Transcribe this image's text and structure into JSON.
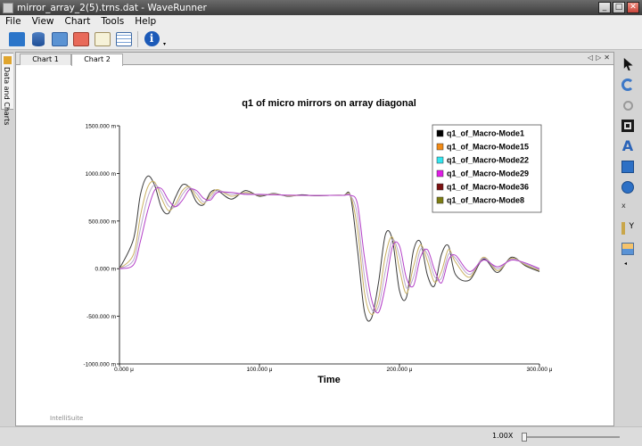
{
  "window": {
    "title": "mirror_array_2(5).trns.dat - WaveRunner",
    "minimize": "_",
    "maximize": "□",
    "close": "✕"
  },
  "menu": [
    "File",
    "View",
    "Chart",
    "Tools",
    "Help"
  ],
  "toolbar": {
    "icons": [
      "folder-open-icon",
      "database-icon",
      "add-data-icon",
      "remove-data-icon",
      "waveform-icon",
      "table-icon",
      "info-icon"
    ],
    "info_glyph": "i",
    "more_glyph": "▾"
  },
  "left_tab": {
    "label": "Data and Charts"
  },
  "tabs": [
    {
      "label": "Chart 1"
    },
    {
      "label": "Chart 2",
      "active": true
    }
  ],
  "tab_nav": {
    "prev": "◁",
    "next": "▷",
    "close": "✕"
  },
  "chart_data": {
    "type": "line",
    "title": "q1 of micro mirrors on array diagonal",
    "xlabel": "Time",
    "ylabel": "",
    "xlim": [
      0,
      300
    ],
    "ylim": [
      -1000,
      1500
    ],
    "x_unit": "μ",
    "y_unit": "m",
    "xticks": [
      "0.000 μ",
      "100.000 μ",
      "200.000 μ",
      "300.000 μ"
    ],
    "xtick_values": [
      0,
      100,
      200,
      300
    ],
    "yticks": [
      "1500.000 m",
      "1000.000 m",
      "500.000 m",
      "0.000 m",
      "-500.000 m",
      "-1000.000 m"
    ],
    "ytick_values": [
      1500,
      1000,
      500,
      0,
      -500,
      -1000
    ],
    "grid": false,
    "legend_position": "top-right",
    "series": [
      {
        "name": "q1_of_Macro-Mode1",
        "color": "#000000",
        "line_color": "#3a3a3a",
        "x": [
          0,
          10,
          15,
          20,
          25,
          30,
          35,
          40,
          45,
          50,
          55,
          60,
          65,
          70,
          80,
          90,
          100,
          110,
          120,
          130,
          140,
          150,
          160,
          165,
          170,
          175,
          180,
          185,
          190,
          195,
          200,
          205,
          210,
          215,
          220,
          225,
          230,
          235,
          240,
          250,
          260,
          270,
          280,
          290,
          300
        ],
        "y": [
          0,
          310,
          780,
          970,
          880,
          640,
          580,
          750,
          880,
          850,
          700,
          670,
          800,
          820,
          730,
          820,
          760,
          790,
          760,
          775,
          765,
          770,
          770,
          760,
          200,
          -450,
          -520,
          -150,
          360,
          300,
          -230,
          -300,
          190,
          280,
          -70,
          -180,
          150,
          240,
          -60,
          -120,
          100,
          -40,
          120,
          30,
          -30
        ]
      },
      {
        "name": "q1_of_Macro-Mode15",
        "color": "#f28a14",
        "line_color": "#c9b060",
        "x": [
          0,
          10,
          15,
          20,
          25,
          30,
          35,
          40,
          45,
          50,
          55,
          60,
          65,
          70,
          80,
          90,
          100,
          110,
          120,
          130,
          140,
          150,
          160,
          165,
          170,
          175,
          180,
          185,
          190,
          195,
          200,
          205,
          210,
          215,
          220,
          225,
          230,
          235,
          240,
          250,
          260,
          270,
          280,
          290,
          300
        ],
        "y": [
          0,
          150,
          560,
          850,
          910,
          740,
          610,
          680,
          820,
          860,
          750,
          680,
          770,
          830,
          760,
          800,
          770,
          785,
          765,
          770,
          768,
          770,
          770,
          765,
          420,
          -250,
          -480,
          -320,
          140,
          330,
          0,
          -260,
          20,
          250,
          80,
          -140,
          -30,
          200,
          70,
          -90,
          120,
          -20,
          110,
          40,
          -20
        ]
      },
      {
        "name": "q1_of_Macro-Mode22",
        "color": "#33e6f0",
        "line_color": "#b9a7cc",
        "x": [
          0,
          10,
          15,
          20,
          25,
          30,
          35,
          40,
          45,
          50,
          55,
          60,
          65,
          70,
          80,
          90,
          100,
          110,
          120,
          130,
          140,
          150,
          160,
          165,
          170,
          175,
          180,
          185,
          190,
          195,
          200,
          205,
          210,
          215,
          220,
          225,
          230,
          235,
          240,
          250,
          260,
          270,
          280,
          290,
          300
        ],
        "y": [
          0,
          90,
          420,
          740,
          880,
          800,
          660,
          650,
          780,
          850,
          790,
          700,
          740,
          820,
          780,
          790,
          775,
          780,
          770,
          770,
          768,
          770,
          770,
          768,
          560,
          -80,
          -420,
          -400,
          -20,
          300,
          130,
          -200,
          -90,
          200,
          150,
          -80,
          -100,
          150,
          110,
          -60,
          110,
          0,
          100,
          50,
          -10
        ]
      },
      {
        "name": "q1_of_Macro-Mode29",
        "color": "#e01ce6",
        "line_color": "#b440c8",
        "x": [
          0,
          10,
          15,
          20,
          25,
          30,
          35,
          40,
          45,
          50,
          55,
          60,
          65,
          70,
          80,
          90,
          100,
          110,
          120,
          130,
          140,
          150,
          160,
          165,
          170,
          175,
          180,
          185,
          190,
          195,
          200,
          205,
          210,
          215,
          220,
          225,
          230,
          235,
          240,
          250,
          260,
          270,
          280,
          290,
          300
        ],
        "y": [
          0,
          40,
          290,
          600,
          820,
          840,
          720,
          650,
          720,
          830,
          820,
          740,
          720,
          800,
          800,
          780,
          780,
          775,
          772,
          770,
          768,
          770,
          770,
          770,
          680,
          120,
          -320,
          -460,
          -180,
          230,
          240,
          -100,
          -180,
          120,
          200,
          -10,
          -150,
          90,
          140,
          -30,
          90,
          20,
          90,
          60,
          0
        ]
      },
      {
        "name": "q1_of_Macro-Mode36",
        "color": "#7a1010",
        "line_color": "#7a1010",
        "x": [],
        "y": []
      },
      {
        "name": "q1_of_Macro-Mode8",
        "color": "#7d7d12",
        "line_color": "#7d7d12",
        "x": [],
        "y": []
      }
    ]
  },
  "watermark": "IntelliSuite",
  "right_tools": [
    "pointer-icon",
    "undo-icon",
    "zoom-icon",
    "frame-icon",
    "text-icon",
    "rectangle-icon",
    "ellipse-icon",
    "x-axis-icon",
    "y-axis-icon",
    "layout-icon"
  ],
  "right_tool_glyphs": {
    "text": "A",
    "x_axis": "x",
    "y_axis": "Y"
  },
  "status": {
    "zoom": "1.00X",
    "zoom_fraction": 0
  }
}
